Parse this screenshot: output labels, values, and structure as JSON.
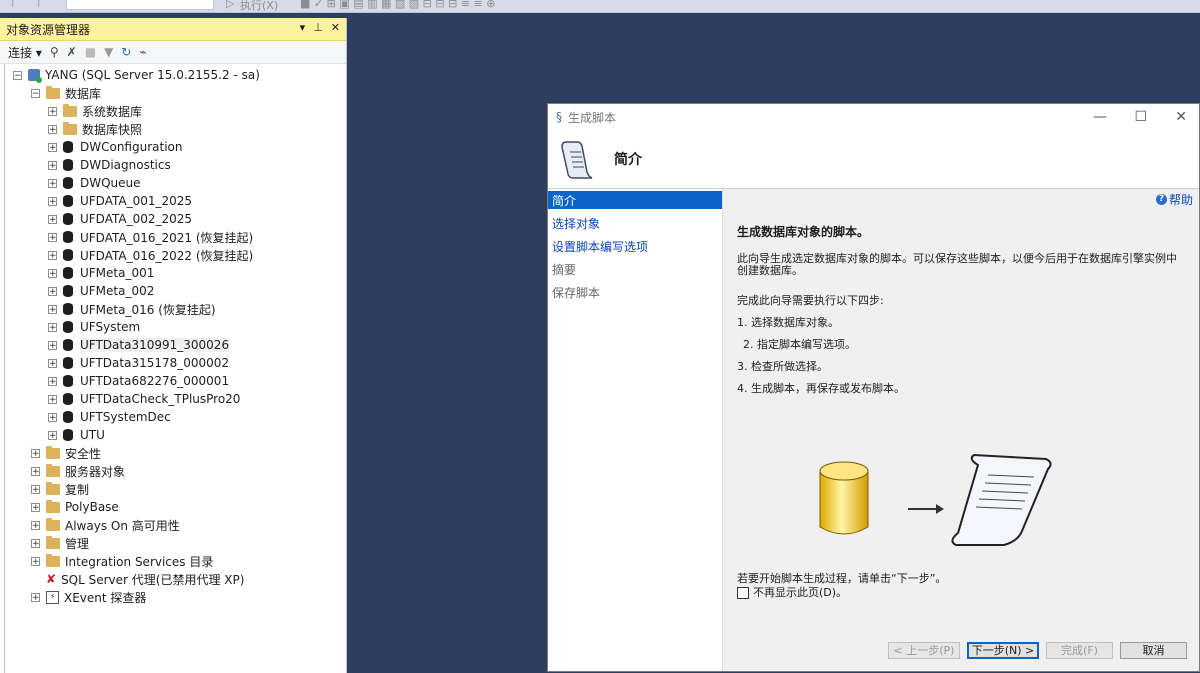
{
  "toolbar": {
    "execute_label": "执行(X)"
  },
  "object_explorer": {
    "title": "对象资源管理器",
    "connect_label": "连接",
    "server": "YANG (SQL Server 15.0.2155.2 - sa)",
    "databases_folder": "数据库",
    "db_subfolders": [
      "系统数据库",
      "数据库快照"
    ],
    "databases": [
      "DWConfiguration",
      "DWDiagnostics",
      "DWQueue",
      "UFDATA_001_2025",
      "UFDATA_002_2025",
      "UFDATA_016_2021 (恢复挂起)",
      "UFDATA_016_2022 (恢复挂起)",
      "UFMeta_001",
      "UFMeta_002",
      "UFMeta_016 (恢复挂起)",
      "UFSystem",
      "UFTData310991_300026",
      "UFTData315178_000002",
      "UFTData682276_000001",
      "UFTDataCheck_TPlusPro20",
      "UFTSystemDec",
      "UTU"
    ],
    "other_nodes": [
      "安全性",
      "服务器对象",
      "复制",
      "PolyBase",
      "Always On 高可用性",
      "管理",
      "Integration Services 目录"
    ],
    "agent": "SQL Server 代理(已禁用代理 XP)",
    "xevent": "XEvent 探查器"
  },
  "dialog": {
    "title": "生成脚本",
    "header": "简介",
    "nav": [
      "简介",
      "选择对象",
      "设置脚本编写选项",
      "摘要",
      "保存脚本"
    ],
    "help": "帮助",
    "heading": "生成数据库对象的脚本。",
    "desc": "此向导生成选定数据库对象的脚本。可以保存这些脚本，以便今后用于在数据库引擎实例中创建数据库。",
    "steps_intro": "完成此向导需要执行以下四步:",
    "steps": [
      "1. 选择数据库对象。",
      "2. 指定脚本编写选项。",
      "3. 检查所做选择。",
      "4. 生成脚本，再保存或发布脚本。"
    ],
    "start_hint": "若要开始脚本生成过程，请单击“下一步”。",
    "dont_show": "不再显示此页(D)。",
    "buttons": {
      "prev": "< 上一步(P)",
      "next": "下一步(N) >",
      "finish": "完成(F)",
      "cancel": "取消"
    }
  }
}
